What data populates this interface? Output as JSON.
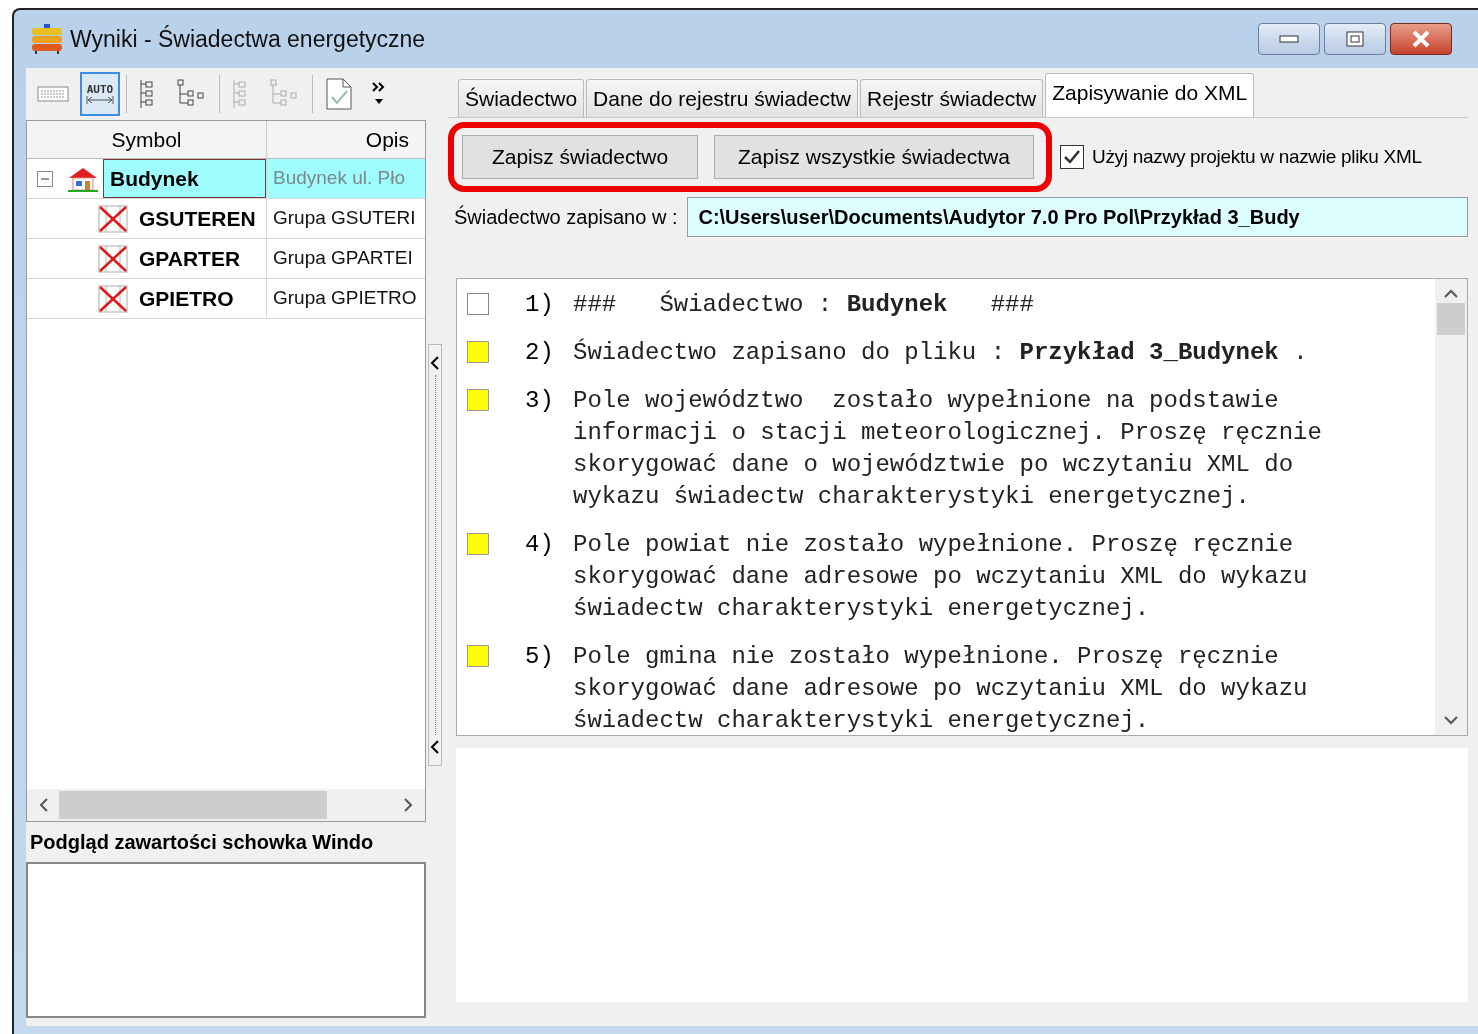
{
  "window": {
    "title": "Wyniki - Świadectwa energetyczne"
  },
  "toolbar": [
    {
      "kind": "keyboard",
      "selected": false
    },
    {
      "kind": "auto",
      "label": "AUTO",
      "selected": true
    },
    {
      "kind": "tree-list",
      "selected": false
    },
    {
      "kind": "tree",
      "selected": false
    },
    {
      "kind": "tree-list-dim",
      "selected": false
    },
    {
      "kind": "tree-dim",
      "selected": false
    },
    {
      "kind": "document",
      "selected": false
    },
    {
      "kind": "more",
      "selected": false
    }
  ],
  "tree": {
    "columns": [
      "Symbol",
      "Opis"
    ],
    "rows": [
      {
        "symbol": "Budynek",
        "description": "Budynek ul. Pło",
        "kind": "building",
        "expanded": true,
        "selected": true,
        "children": [
          {
            "symbol": "GSUTEREN",
            "description": "Grupa GSUTERI",
            "kind": "group",
            "selected": false
          },
          {
            "symbol": "GPARTER",
            "description": "Grupa GPARTEI",
            "kind": "group",
            "selected": false
          },
          {
            "symbol": "GPIETRO",
            "description": "Grupa GPIETRO",
            "kind": "group",
            "selected": false
          }
        ]
      }
    ]
  },
  "clipboard": {
    "label": "Podgląd zawartości schowka Windo"
  },
  "tabs": [
    {
      "label": "Świadectwo",
      "selected": false
    },
    {
      "label": "Dane do rejestru świadectw",
      "selected": false
    },
    {
      "label": "Rejestr świadectw",
      "selected": false
    },
    {
      "label": "Zapisywanie do XML",
      "selected": true
    }
  ],
  "buttons": [
    "Zapisz świadectwo",
    "Zapisz wszystkie świadectwa"
  ],
  "use_project_name": {
    "label": "Użyj nazwy projektu w nazwie pliku XML",
    "checked": true
  },
  "saved_path": {
    "label": "Świadectwo zapisano w :",
    "value": "C:\\Users\\user\\Documents\\Audytor 7.0 Pro Pol\\Przykład 3_Budy"
  },
  "messages": [
    {
      "number": "1)",
      "kind": "info",
      "lines": [
        "###   Świadectwo : **Budynek**   ###"
      ]
    },
    {
      "number": "2)",
      "kind": "warning",
      "lines": [
        "Świadectwo zapisano do pliku : **Przykład 3_Budynek** ."
      ]
    },
    {
      "number": "3)",
      "kind": "warning",
      "lines": [
        "Pole województwo  zostało wypełnione na podstawie",
        "informacji o stacji meteorologicznej. Proszę ręcznie",
        "skorygować dane o województwie po wczytaniu XML do",
        "wykazu świadectw charakterystyki energetycznej."
      ]
    },
    {
      "number": "4)",
      "kind": "warning",
      "lines": [
        "Pole powiat nie zostało wypełnione. Proszę ręcznie",
        "skorygować dane adresowe po wczytaniu XML do wykazu",
        "świadectw charakterystyki energetycznej."
      ]
    },
    {
      "number": "5)",
      "kind": "warning",
      "lines": [
        "Pole gmina nie zostało wypełnione. Proszę ręcznie",
        "skorygować dane adresowe po wczytaniu XML do wykazu",
        "świadectw charakterystyki energetycznej."
      ]
    }
  ]
}
